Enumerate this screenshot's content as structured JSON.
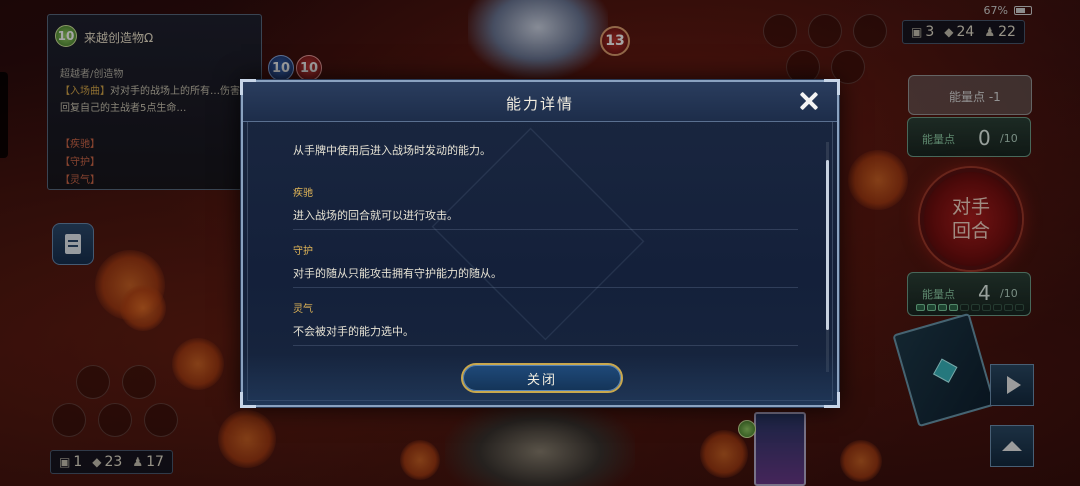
{
  "status_bar": {
    "battery": "67%",
    "battery_level": 0.67
  },
  "opponent_counts": {
    "hand": "3",
    "deck": "24",
    "shadows": "22"
  },
  "player_counts": {
    "hand": "1",
    "deck": "23",
    "shadows": "17"
  },
  "opponent_leader": {
    "hp": "13"
  },
  "card_detail": {
    "cost": "10",
    "name": "来越创造物Ω",
    "attack": "10",
    "defense": "10",
    "type": "超越者/创造物",
    "effect_tag": "【入场曲】",
    "effect_text": "对对手的战场上的所有…伤害。回复自己的主战者5点生命…",
    "keywords": [
      "【疾驰】",
      "【守护】",
      "【灵气】"
    ]
  },
  "pp_top": {
    "label": "能量点 -1"
  },
  "pp_opponent": {
    "label": "能量点",
    "value": "0",
    "max": "/10"
  },
  "turn_button": {
    "line1": "对手",
    "line2": "回合"
  },
  "pp_player": {
    "label": "能量点",
    "value": "4",
    "max": "/10",
    "pips_filled": 4,
    "pips_total": 10
  },
  "modal": {
    "title": "能力详情",
    "intro": "从手牌中使用后进入战场时发动的能力。",
    "keywords": [
      {
        "title": "疾驰",
        "desc": "进入战场的回合就可以进行攻击。"
      },
      {
        "title": "守护",
        "desc": "对手的随从只能攻击拥有守护能力的随从。"
      },
      {
        "title": "灵气",
        "desc": "不会被对手的能力选中。"
      }
    ],
    "close_label": "关闭"
  },
  "colors": {
    "accent_gold": "#c9a84e",
    "modal_bg": "#14203a",
    "keyword_gold": "#e2b657",
    "turn_red": "#b01e1e"
  }
}
